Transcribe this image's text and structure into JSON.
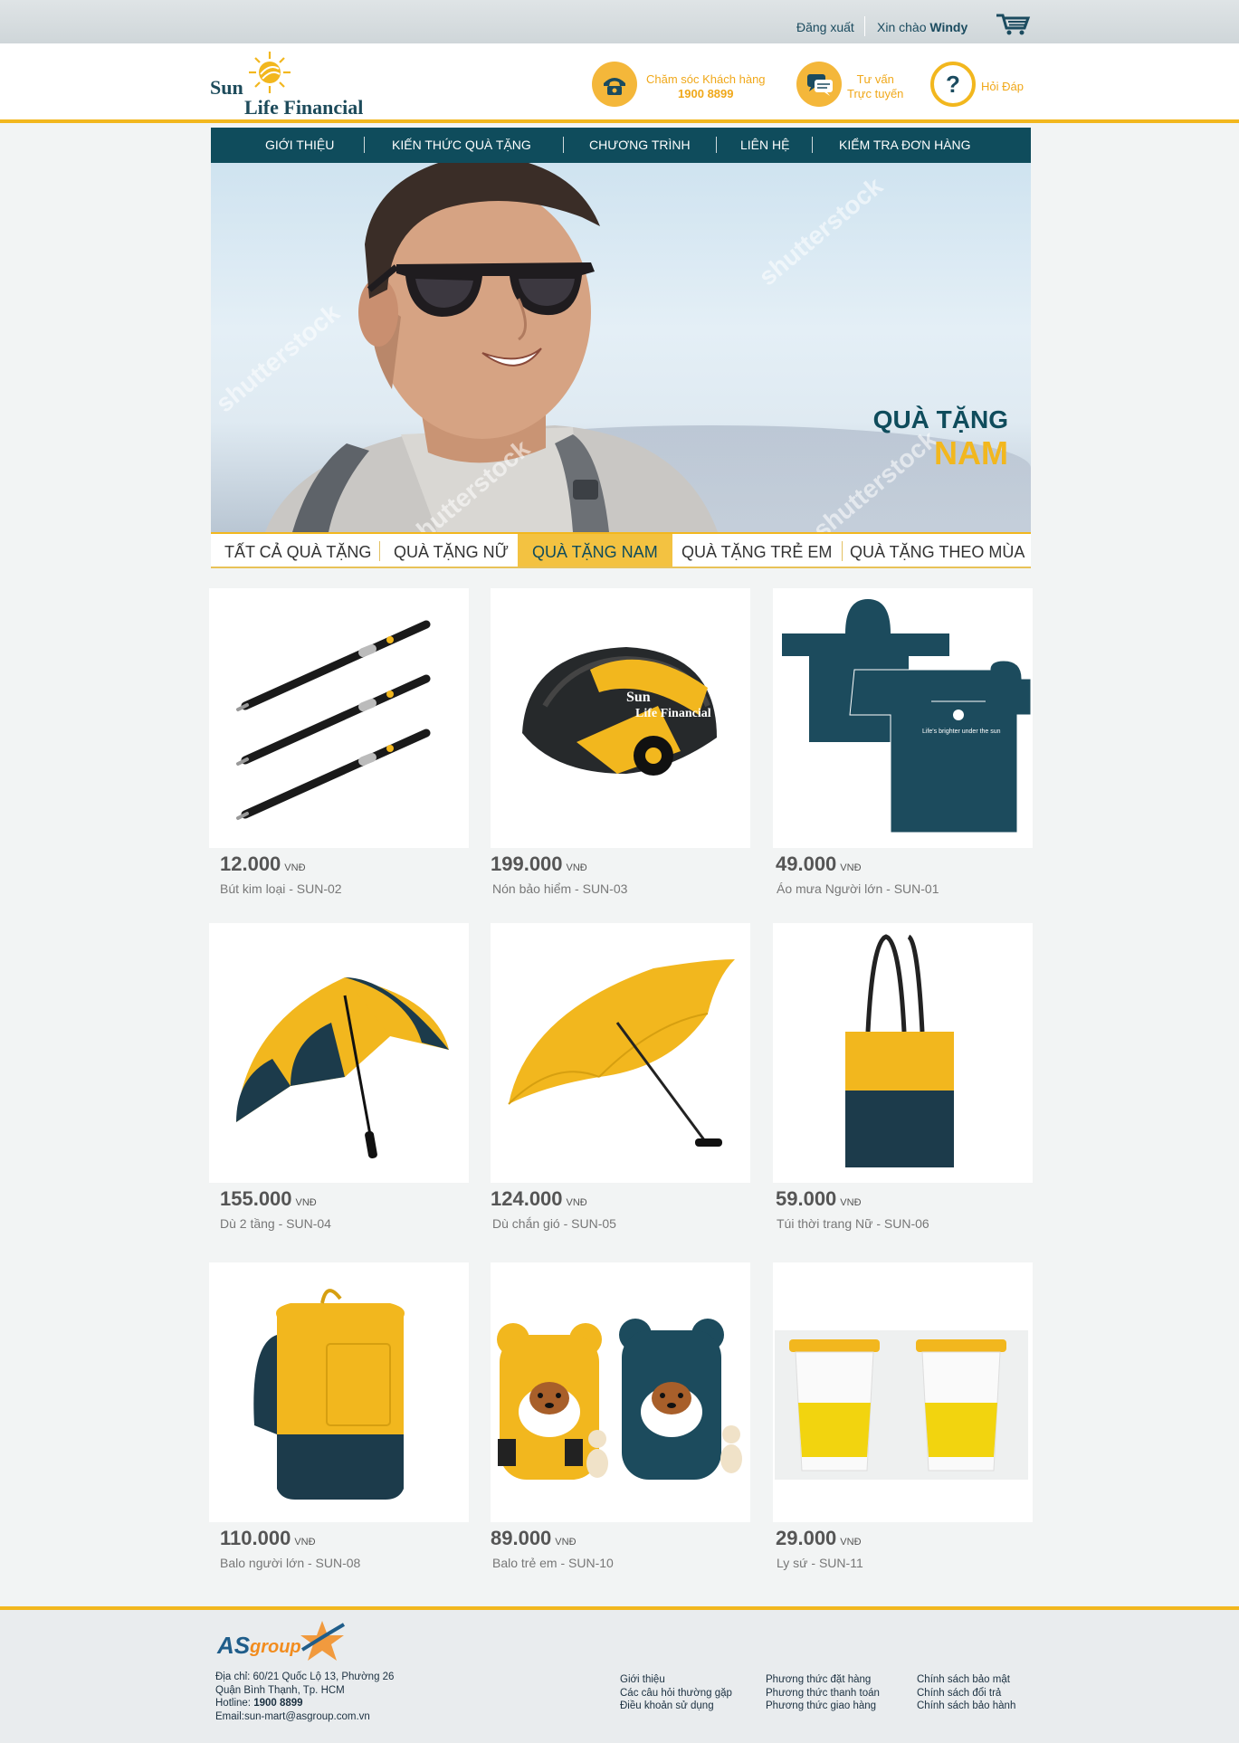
{
  "topbar": {
    "logout": "Đăng xuất",
    "greeting": "Xin chào",
    "username": "Windy"
  },
  "header": {
    "brand_line1": "Sun",
    "brand_line2": "Life Financial",
    "support_label": "Chăm sóc Khách hàng",
    "support_phone": "1900 8899",
    "consult_line1": "Tư vấn",
    "consult_line2": "Trực tuyến",
    "faq_label": "Hỏi Đáp"
  },
  "nav": {
    "items": [
      "GIỚI THIỆU",
      "KIẾN THỨC QUÀ TẶNG",
      "CHƯƠNG TRÌNH",
      "LIÊN HỆ",
      "KIỂM TRA ĐƠN HÀNG"
    ]
  },
  "banner": {
    "title_line1": "QUÀ TẶNG",
    "title_line2": "NAM",
    "watermark": "shutterstock"
  },
  "tabs": {
    "items": [
      "TẤT CẢ QUÀ TẶNG",
      "QUÀ TẶNG NỮ",
      "QUÀ TẶNG NAM",
      "QUÀ TẶNG TRẺ EM",
      "QUÀ TẶNG THEO MÙA"
    ],
    "active_index": 2
  },
  "currency": "VNĐ",
  "products": [
    {
      "price": "12.000",
      "name": "Bút kim loại - SUN-02"
    },
    {
      "price": "199.000",
      "name": "Nón bảo hiểm - SUN-03"
    },
    {
      "price": "49.000",
      "name": "Áo mưa Người lớn - SUN-01"
    },
    {
      "price": "155.000",
      "name": "Dù 2 tầng - SUN-04"
    },
    {
      "price": "124.000",
      "name": "Dù chắn gió - SUN-05"
    },
    {
      "price": "59.000",
      "name": "Túi thời trang Nữ - SUN-06"
    },
    {
      "price": "110.000",
      "name": "Balo người lớn - SUN-08"
    },
    {
      "price": "89.000",
      "name": "Balo trẻ em - SUN-10"
    },
    {
      "price": "29.000",
      "name": "Ly sứ - SUN-11"
    }
  ],
  "footer": {
    "brand_as": "AS",
    "brand_group": "group",
    "address_line1": "Địa chỉ: 60/21 Quốc Lộ 13, Phường 26",
    "address_line2": "Quận Bình Thạnh, Tp. HCM",
    "hotline_label": "Hotline:",
    "hotline": "1900 8899",
    "email": "Email:sun-mart@asgroup.com.vn",
    "col1": [
      "Giới thiệu",
      "Các câu hỏi thường gặp",
      "Điều khoản sử dụng"
    ],
    "col2": [
      "Phương thức đặt hàng",
      "Phương thức thanh toán",
      "Phương thức giao hàng"
    ],
    "col3": [
      "Chính sách bảo mật",
      "Chính sách đổi trả",
      "Chính sách bảo hành"
    ]
  },
  "colors": {
    "navy": "#0f4c5c",
    "yellow": "#f2b71e"
  }
}
